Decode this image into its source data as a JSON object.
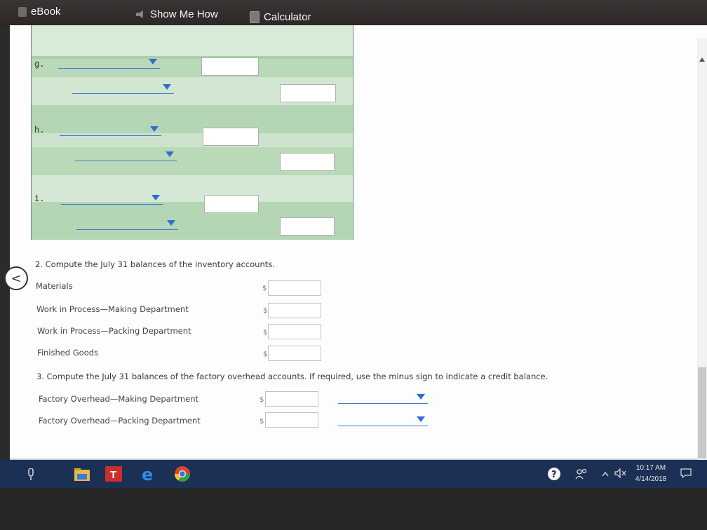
{
  "toolbar": {
    "ebook": "eBook",
    "show_me_how": "Show Me How",
    "calculator": "Calculator"
  },
  "table": {
    "rows": [
      {
        "label": "g."
      },
      {
        "label": "h."
      },
      {
        "label": "i."
      }
    ]
  },
  "q2": {
    "prompt": "2.  Compute the July 31 balances of the inventory accounts.",
    "dollar": "$",
    "items": [
      {
        "label": "Materials"
      },
      {
        "label": "Work in Process—Making Department"
      },
      {
        "label": "Work in Process—Packing Department"
      },
      {
        "label": "Finished Goods"
      }
    ]
  },
  "q3": {
    "prompt": "3.  Compute the July 31 balances of the factory overhead accounts. If required, use the minus sign to indicate a credit balance.",
    "dollar": "$",
    "items": [
      {
        "label": "Factory Overhead—Making Department"
      },
      {
        "label": "Factory Overhead—Packing Department"
      }
    ]
  },
  "nav": {
    "prev": "<"
  },
  "taskbar": {
    "time": "10:17 AM",
    "date": "4/14/2018"
  },
  "colors": {
    "dropdown_arrow": "#2f6fd0",
    "taskbar": "#1c2f55",
    "table_green": "#cfe3cf"
  }
}
